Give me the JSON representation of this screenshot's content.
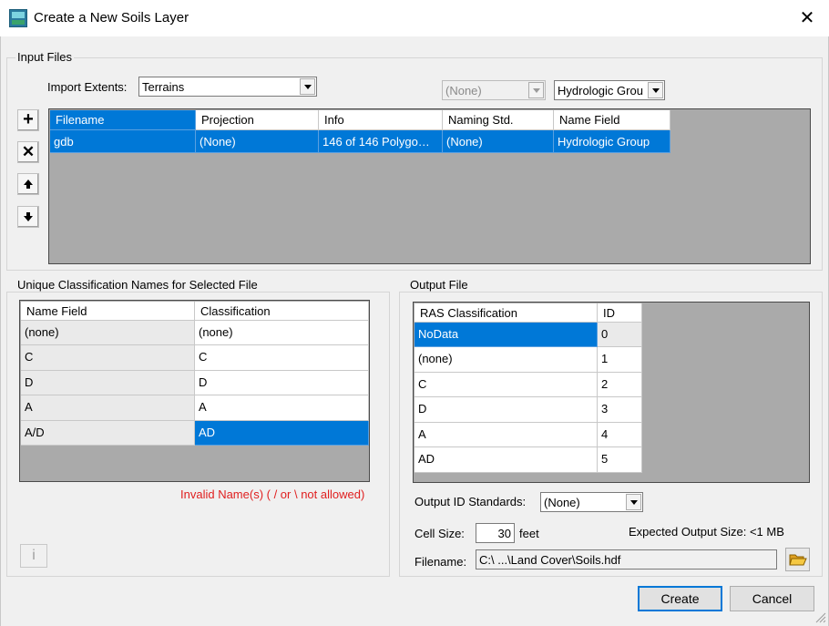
{
  "window": {
    "title": "Create a New Soils Layer",
    "close_glyph": "✕"
  },
  "input_files": {
    "group_label": "Input Files",
    "import_extents_label": "Import Extents:",
    "import_extents_value": "Terrains",
    "naming_std_value": "(None)",
    "name_field_value": "Hydrologic Grou",
    "columns": [
      "Filename",
      "Projection",
      "Info",
      "Naming Std.",
      "Name Field"
    ],
    "rows": [
      [
        "gdb",
        "(None)",
        "146 of 146 Polygo…",
        "(None)",
        "Hydrologic Group"
      ]
    ],
    "tool_buttons": {
      "add": "+",
      "remove": "✕",
      "up": "🠝",
      "down": "🠟"
    }
  },
  "unique_names": {
    "group_label": "Unique Classification Names for Selected File",
    "columns": [
      "Name Field",
      "Classification"
    ],
    "rows": [
      [
        "(none)",
        "(none)"
      ],
      [
        "C",
        "C"
      ],
      [
        "D",
        "D"
      ],
      [
        "A",
        "A"
      ],
      [
        "A/D",
        "AD"
      ]
    ],
    "invalid_text": "Invalid Name(s) ( / or \\ not allowed)",
    "info_button": "i"
  },
  "output_file": {
    "group_label": "Output File",
    "columns": [
      "RAS Classification",
      "ID"
    ],
    "rows": [
      [
        "NoData",
        "0"
      ],
      [
        "(none)",
        "1"
      ],
      [
        "C",
        "2"
      ],
      [
        "D",
        "3"
      ],
      [
        "A",
        "4"
      ],
      [
        "AD",
        "5"
      ]
    ],
    "output_id_label": "Output ID Standards:",
    "output_id_value": "(None)",
    "cell_size_label": "Cell Size:",
    "cell_size_value": "30",
    "cell_size_unit": "feet",
    "expected_size": "Expected Output Size: <1 MB",
    "filename_label": "Filename:",
    "filename_value": "C:\\ ...\\Land Cover\\Soils.hdf"
  },
  "footer": {
    "create": "Create",
    "cancel": "Cancel"
  },
  "colors": {
    "selection": "#0078d7",
    "error": "#e02020",
    "grid_bg": "#aaaaaa"
  }
}
